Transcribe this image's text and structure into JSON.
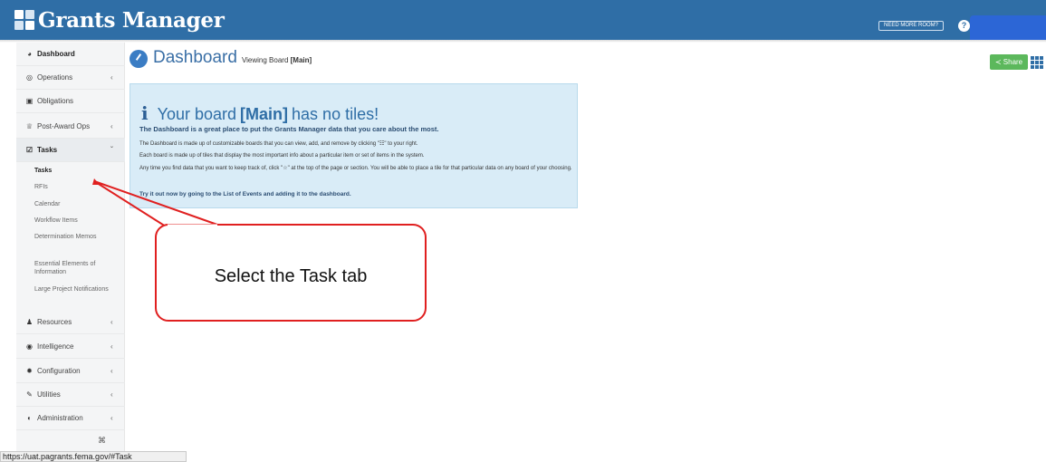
{
  "app": {
    "title": "Grants Manager",
    "need_more_room": "NEED MORE ROOM?",
    "help_glyph": "?"
  },
  "sidebar": {
    "items": [
      {
        "label": "Dashboard",
        "icon": "dashboard-icon",
        "glyph": "◕",
        "chev": ""
      },
      {
        "label": "Operations",
        "icon": "operations-icon",
        "glyph": "◎",
        "chev": "‹"
      },
      {
        "label": "Obligations",
        "icon": "obligations-icon",
        "glyph": "▣",
        "chev": ""
      },
      {
        "label": "Post-Award Ops",
        "icon": "trophy-icon",
        "glyph": "♕",
        "chev": "‹"
      },
      {
        "label": "Tasks",
        "icon": "tasks-icon",
        "glyph": "☑",
        "chev": "ˇ"
      },
      {
        "label": "Resources",
        "icon": "users-icon",
        "glyph": "♟",
        "chev": "‹"
      },
      {
        "label": "Intelligence",
        "icon": "eye-icon",
        "glyph": "◉",
        "chev": "‹"
      },
      {
        "label": "Configuration",
        "icon": "gear-icon",
        "glyph": "✹",
        "chev": "‹"
      },
      {
        "label": "Utilities",
        "icon": "wrench-icon",
        "glyph": "✎",
        "chev": "‹"
      },
      {
        "label": "Administration",
        "icon": "shield-icon",
        "glyph": "◐",
        "chev": "‹"
      }
    ],
    "task_subitems": [
      "Tasks",
      "RFIs",
      "Calendar",
      "Workflow Items",
      "Determination Memos",
      "Essential Elements of Information",
      "Large Project Notifications"
    ],
    "collapse_glyph": "⌘"
  },
  "main": {
    "title": "Dashboard",
    "viewing_prefix": "Viewing Board",
    "board_name": "[Main]",
    "share_label": "Share",
    "share_glyph": "≺"
  },
  "info": {
    "heading_pre": "Your board",
    "heading_board": "[Main]",
    "heading_post": "has no tiles!",
    "lead": "The Dashboard is a great place to put the Grants Manager data that you care about the most.",
    "line1": "The Dashboard is made up of customizable boards that you can view, add, and remove by clicking \"☷\" to your right.",
    "line2": "Each board is made up of tiles that display the most important info about a particular item or set of items in the system.",
    "line3": "Any time you find data that you want to keep track of, click \"☆\" at the top of the page or section. You will be able to place a tile for that particular data on any board of your choosing.",
    "link": "Try it out now by going to the List of Events and adding it to the dashboard."
  },
  "callout": {
    "text": "Select the Task tab"
  },
  "status_url": "https://uat.pagrants.fema.gov/#Task",
  "colors": {
    "topbar": "#2f6ea6",
    "info_bg": "#d9ecf7",
    "share": "#5cb85c",
    "callout_border": "#e02020"
  }
}
